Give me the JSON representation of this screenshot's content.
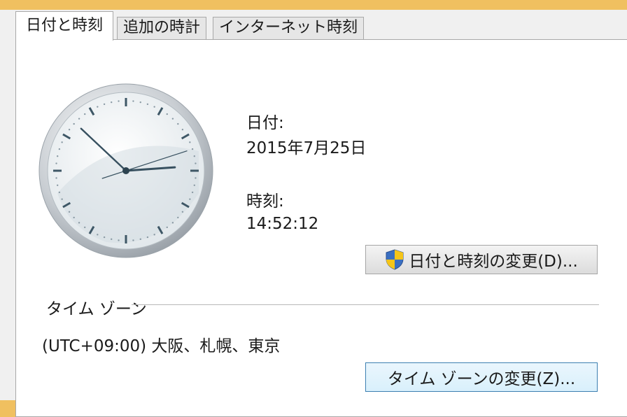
{
  "tabs": [
    {
      "label": "日付と時刻",
      "active": true
    },
    {
      "label": "追加の時計",
      "active": false
    },
    {
      "label": "インターネット時刻",
      "active": false
    }
  ],
  "date": {
    "label": "日付:",
    "value": "2015年7月25日"
  },
  "time": {
    "label": "時刻:",
    "value": "14:52:12",
    "hour": 14,
    "minute": 52,
    "second": 12
  },
  "change_datetime_button": {
    "label": "日付と時刻の変更(D)...",
    "icon": "uac-shield-icon"
  },
  "timezone": {
    "group_label": "タイム ゾーン",
    "value": "(UTC+09:00) 大阪、札幌、東京",
    "change_button": "タイム ゾーンの変更(Z)..."
  },
  "colors": {
    "accent_border": "#f0c060",
    "focus_border": "#3c7fb1"
  }
}
